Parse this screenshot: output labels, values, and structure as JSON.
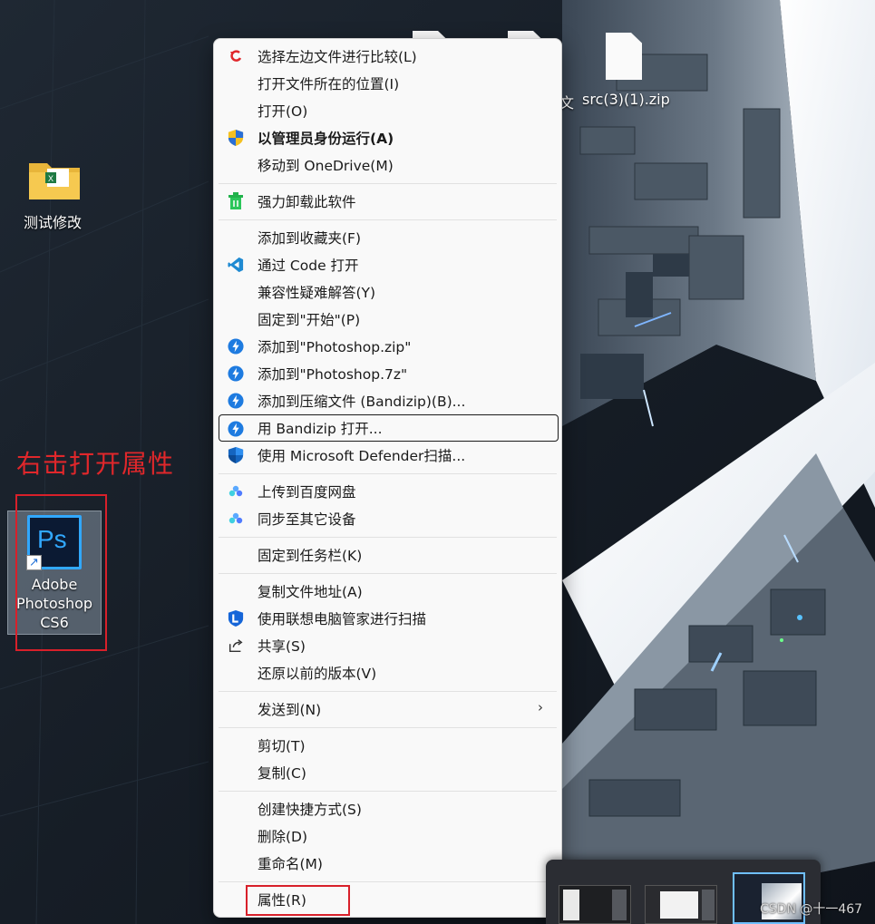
{
  "desktop": {
    "folder_icon_label": "测试修改",
    "partial_label": "文",
    "zip_icon_label": "src(3)(1).zip",
    "shortcut": {
      "icon_text": "Ps",
      "label_line1": "Adobe",
      "label_line2": "Photoshop",
      "label_line3": "CS6"
    }
  },
  "annotation": {
    "text": "右击打开属性",
    "color": "#e0272b"
  },
  "context_menu": {
    "items": [
      {
        "label": "选择左边文件进行比较(L)",
        "icon": "compare-arrow-icon"
      },
      {
        "label": "打开文件所在的位置(I)",
        "icon": ""
      },
      {
        "label": "打开(O)",
        "icon": ""
      },
      {
        "label": "以管理员身份运行(A)",
        "icon": "uac-shield-icon"
      },
      {
        "label": "移动到 OneDrive(M)",
        "icon": ""
      },
      {
        "label": "强力卸载此软件",
        "icon": "uninstall-icon"
      },
      {
        "label": "添加到收藏夹(F)",
        "icon": ""
      },
      {
        "label": "通过 Code 打开",
        "icon": "vscode-icon"
      },
      {
        "label": "兼容性疑难解答(Y)",
        "icon": ""
      },
      {
        "label": "固定到\"开始\"(P)",
        "icon": ""
      },
      {
        "label": "添加到\"Photoshop.zip\"",
        "icon": "bandizip-icon"
      },
      {
        "label": "添加到\"Photoshop.7z\"",
        "icon": "bandizip-icon"
      },
      {
        "label": "添加到压缩文件 (Bandizip)(B)...",
        "icon": "bandizip-icon"
      },
      {
        "label": "用 Bandizip 打开...",
        "icon": "bandizip-icon"
      },
      {
        "label": "使用 Microsoft Defender扫描...",
        "icon": "defender-shield-icon"
      },
      {
        "label": "上传到百度网盘",
        "icon": "baidu-netdisk-icon"
      },
      {
        "label": "同步至其它设备",
        "icon": "baidu-netdisk-icon"
      },
      {
        "label": "固定到任务栏(K)",
        "icon": ""
      },
      {
        "label": "复制文件地址(A)",
        "icon": ""
      },
      {
        "label": "使用联想电脑管家进行扫描",
        "icon": "lenovo-guard-icon"
      },
      {
        "label": "共享(S)",
        "icon": "share-icon"
      },
      {
        "label": "还原以前的版本(V)",
        "icon": ""
      },
      {
        "label": "发送到(N)",
        "icon": "",
        "submenu_arrow": "›"
      },
      {
        "label": "剪切(T)",
        "icon": ""
      },
      {
        "label": "复制(C)",
        "icon": ""
      },
      {
        "label": "创建快捷方式(S)",
        "icon": ""
      },
      {
        "label": "删除(D)",
        "icon": ""
      },
      {
        "label": "重命名(M)",
        "icon": ""
      },
      {
        "label": "属性(R)",
        "icon": ""
      }
    ]
  },
  "watermark": "CSDN @十一467",
  "colors": {
    "menu_bg": "#f9f9f9",
    "highlight_red": "#d8202a",
    "bandizip_blue": "#1e7be0",
    "ps_blue": "#31a8ff"
  }
}
